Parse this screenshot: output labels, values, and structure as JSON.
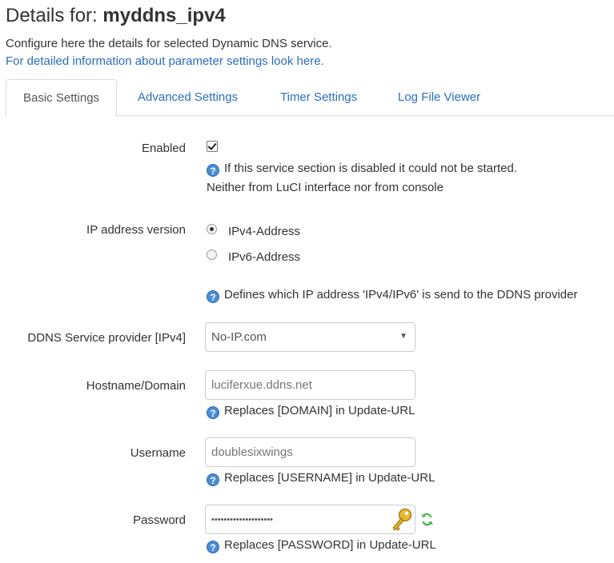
{
  "header": {
    "title_prefix": "Details for:",
    "title_name": "myddns_ipv4",
    "description": "Configure here the details for selected Dynamic DNS service.",
    "info_link": "For detailed information about parameter settings look here."
  },
  "tabs": [
    {
      "label": "Basic Settings",
      "active": true
    },
    {
      "label": "Advanced Settings",
      "active": false
    },
    {
      "label": "Timer Settings",
      "active": false
    },
    {
      "label": "Log File Viewer",
      "active": false
    }
  ],
  "form": {
    "enabled": {
      "label": "Enabled",
      "checked": true,
      "help_line1": "If this service section is disabled it could not be started.",
      "help_line2": "Neither from LuCI interface nor from console"
    },
    "ip_version": {
      "label": "IP address version",
      "options": [
        "IPv4-Address",
        "IPv6-Address"
      ],
      "selected": "IPv4-Address",
      "help": "Defines which IP address 'IPv4/IPv6' is send to the DDNS provider"
    },
    "provider": {
      "label": "DDNS Service provider [IPv4]",
      "value": "No-IP.com"
    },
    "hostname": {
      "label": "Hostname/Domain",
      "value": "luciferxue.ddns.net",
      "help": "Replaces [DOMAIN] in Update-URL"
    },
    "username": {
      "label": "Username",
      "value": "doublesixwings",
      "help": "Replaces [USERNAME] in Update-URL"
    },
    "password": {
      "label": "Password",
      "value": "••••••••••••••••••••",
      "help": "Replaces [PASSWORD] in Update-URL"
    }
  },
  "icons": {
    "help": "help-icon",
    "key": "key-icon",
    "reload": "refresh-icon"
  },
  "colors": {
    "link": "#2a6ebd",
    "help_icon": "#4a8cd6",
    "refresh_icon": "#5cb85c"
  }
}
